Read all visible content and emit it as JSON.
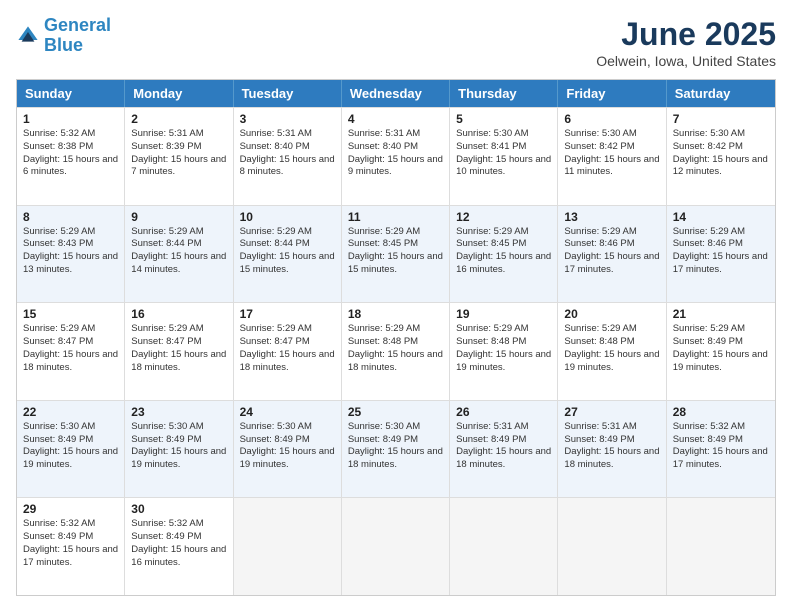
{
  "logo": {
    "line1": "General",
    "line2": "Blue"
  },
  "title": "June 2025",
  "subtitle": "Oelwein, Iowa, United States",
  "headers": [
    "Sunday",
    "Monday",
    "Tuesday",
    "Wednesday",
    "Thursday",
    "Friday",
    "Saturday"
  ],
  "rows": [
    [
      {
        "day": "1",
        "sunrise": "Sunrise: 5:32 AM",
        "sunset": "Sunset: 8:38 PM",
        "daylight": "Daylight: 15 hours and 6 minutes."
      },
      {
        "day": "2",
        "sunrise": "Sunrise: 5:31 AM",
        "sunset": "Sunset: 8:39 PM",
        "daylight": "Daylight: 15 hours and 7 minutes."
      },
      {
        "day": "3",
        "sunrise": "Sunrise: 5:31 AM",
        "sunset": "Sunset: 8:40 PM",
        "daylight": "Daylight: 15 hours and 8 minutes."
      },
      {
        "day": "4",
        "sunrise": "Sunrise: 5:31 AM",
        "sunset": "Sunset: 8:40 PM",
        "daylight": "Daylight: 15 hours and 9 minutes."
      },
      {
        "day": "5",
        "sunrise": "Sunrise: 5:30 AM",
        "sunset": "Sunset: 8:41 PM",
        "daylight": "Daylight: 15 hours and 10 minutes."
      },
      {
        "day": "6",
        "sunrise": "Sunrise: 5:30 AM",
        "sunset": "Sunset: 8:42 PM",
        "daylight": "Daylight: 15 hours and 11 minutes."
      },
      {
        "day": "7",
        "sunrise": "Sunrise: 5:30 AM",
        "sunset": "Sunset: 8:42 PM",
        "daylight": "Daylight: 15 hours and 12 minutes."
      }
    ],
    [
      {
        "day": "8",
        "sunrise": "Sunrise: 5:29 AM",
        "sunset": "Sunset: 8:43 PM",
        "daylight": "Daylight: 15 hours and 13 minutes."
      },
      {
        "day": "9",
        "sunrise": "Sunrise: 5:29 AM",
        "sunset": "Sunset: 8:44 PM",
        "daylight": "Daylight: 15 hours and 14 minutes."
      },
      {
        "day": "10",
        "sunrise": "Sunrise: 5:29 AM",
        "sunset": "Sunset: 8:44 PM",
        "daylight": "Daylight: 15 hours and 15 minutes."
      },
      {
        "day": "11",
        "sunrise": "Sunrise: 5:29 AM",
        "sunset": "Sunset: 8:45 PM",
        "daylight": "Daylight: 15 hours and 15 minutes."
      },
      {
        "day": "12",
        "sunrise": "Sunrise: 5:29 AM",
        "sunset": "Sunset: 8:45 PM",
        "daylight": "Daylight: 15 hours and 16 minutes."
      },
      {
        "day": "13",
        "sunrise": "Sunrise: 5:29 AM",
        "sunset": "Sunset: 8:46 PM",
        "daylight": "Daylight: 15 hours and 17 minutes."
      },
      {
        "day": "14",
        "sunrise": "Sunrise: 5:29 AM",
        "sunset": "Sunset: 8:46 PM",
        "daylight": "Daylight: 15 hours and 17 minutes."
      }
    ],
    [
      {
        "day": "15",
        "sunrise": "Sunrise: 5:29 AM",
        "sunset": "Sunset: 8:47 PM",
        "daylight": "Daylight: 15 hours and 18 minutes."
      },
      {
        "day": "16",
        "sunrise": "Sunrise: 5:29 AM",
        "sunset": "Sunset: 8:47 PM",
        "daylight": "Daylight: 15 hours and 18 minutes."
      },
      {
        "day": "17",
        "sunrise": "Sunrise: 5:29 AM",
        "sunset": "Sunset: 8:47 PM",
        "daylight": "Daylight: 15 hours and 18 minutes."
      },
      {
        "day": "18",
        "sunrise": "Sunrise: 5:29 AM",
        "sunset": "Sunset: 8:48 PM",
        "daylight": "Daylight: 15 hours and 18 minutes."
      },
      {
        "day": "19",
        "sunrise": "Sunrise: 5:29 AM",
        "sunset": "Sunset: 8:48 PM",
        "daylight": "Daylight: 15 hours and 19 minutes."
      },
      {
        "day": "20",
        "sunrise": "Sunrise: 5:29 AM",
        "sunset": "Sunset: 8:48 PM",
        "daylight": "Daylight: 15 hours and 19 minutes."
      },
      {
        "day": "21",
        "sunrise": "Sunrise: 5:29 AM",
        "sunset": "Sunset: 8:49 PM",
        "daylight": "Daylight: 15 hours and 19 minutes."
      }
    ],
    [
      {
        "day": "22",
        "sunrise": "Sunrise: 5:30 AM",
        "sunset": "Sunset: 8:49 PM",
        "daylight": "Daylight: 15 hours and 19 minutes."
      },
      {
        "day": "23",
        "sunrise": "Sunrise: 5:30 AM",
        "sunset": "Sunset: 8:49 PM",
        "daylight": "Daylight: 15 hours and 19 minutes."
      },
      {
        "day": "24",
        "sunrise": "Sunrise: 5:30 AM",
        "sunset": "Sunset: 8:49 PM",
        "daylight": "Daylight: 15 hours and 19 minutes."
      },
      {
        "day": "25",
        "sunrise": "Sunrise: 5:30 AM",
        "sunset": "Sunset: 8:49 PM",
        "daylight": "Daylight: 15 hours and 18 minutes."
      },
      {
        "day": "26",
        "sunrise": "Sunrise: 5:31 AM",
        "sunset": "Sunset: 8:49 PM",
        "daylight": "Daylight: 15 hours and 18 minutes."
      },
      {
        "day": "27",
        "sunrise": "Sunrise: 5:31 AM",
        "sunset": "Sunset: 8:49 PM",
        "daylight": "Daylight: 15 hours and 18 minutes."
      },
      {
        "day": "28",
        "sunrise": "Sunrise: 5:32 AM",
        "sunset": "Sunset: 8:49 PM",
        "daylight": "Daylight: 15 hours and 17 minutes."
      }
    ],
    [
      {
        "day": "29",
        "sunrise": "Sunrise: 5:32 AM",
        "sunset": "Sunset: 8:49 PM",
        "daylight": "Daylight: 15 hours and 17 minutes."
      },
      {
        "day": "30",
        "sunrise": "Sunrise: 5:32 AM",
        "sunset": "Sunset: 8:49 PM",
        "daylight": "Daylight: 15 hours and 16 minutes."
      },
      {
        "day": "",
        "sunrise": "",
        "sunset": "",
        "daylight": ""
      },
      {
        "day": "",
        "sunrise": "",
        "sunset": "",
        "daylight": ""
      },
      {
        "day": "",
        "sunrise": "",
        "sunset": "",
        "daylight": ""
      },
      {
        "day": "",
        "sunrise": "",
        "sunset": "",
        "daylight": ""
      },
      {
        "day": "",
        "sunrise": "",
        "sunset": "",
        "daylight": ""
      }
    ]
  ]
}
